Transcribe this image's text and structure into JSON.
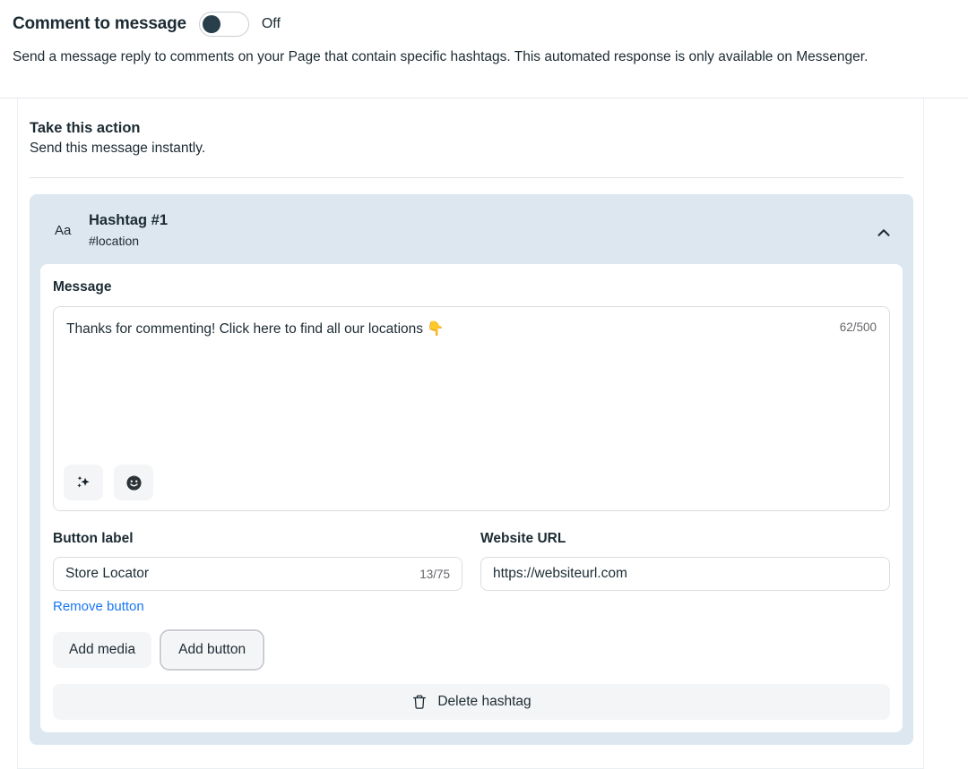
{
  "header": {
    "title": "Comment to message",
    "toggle": {
      "state_label": "Off",
      "is_on": false,
      "knob_color": "#283e4a"
    },
    "description": "Send a message reply to comments on your Page that contain specific hashtags. This automated response is only available on Messenger."
  },
  "action_section": {
    "title": "Take this action",
    "subtitle": "Send this message instantly."
  },
  "hashtag_card": {
    "type_icon": "Aa",
    "name": "Hashtag #1",
    "tag": "#location",
    "collapse_icon": "chevron-up-icon",
    "message": {
      "label": "Message",
      "value": "Thanks for commenting! Click here to find all our locations 👇",
      "counter": "62/500",
      "tools": [
        {
          "name": "ai-sparkles-icon"
        },
        {
          "name": "emoji-icon"
        }
      ]
    },
    "button_label": {
      "label": "Button label",
      "value": "Store Locator",
      "counter": "13/75",
      "remove_link": "Remove button"
    },
    "website_url": {
      "label": "Website URL",
      "value": "https://websiteurl.com"
    },
    "actions": [
      {
        "label": "Add media",
        "focused": false
      },
      {
        "label": "Add button",
        "focused": true
      }
    ],
    "delete": {
      "label": "Delete hashtag",
      "icon": "trash-icon"
    }
  },
  "colors": {
    "accent_link": "#1877f2",
    "card_blue": "#dde7f0",
    "text": "#1c2b33",
    "muted": "#65676b"
  }
}
